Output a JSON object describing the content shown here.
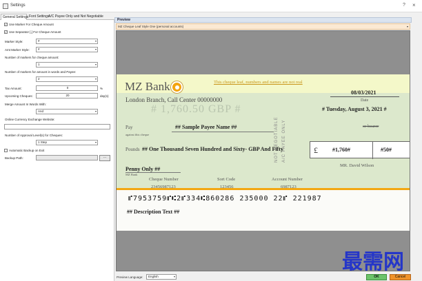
{
  "window": {
    "title": "Settings",
    "help": "?",
    "close": "×"
  },
  "tabs": [
    {
      "label": "General Settings"
    },
    {
      "label": "Font Settings"
    },
    {
      "label": "A/C Payee Only and Not Negotiable"
    }
  ],
  "settings": {
    "use_marker": {
      "label": "Use Marker For Cheque Amount",
      "checked": "✓"
    },
    "use_separator": {
      "label": "Use Separator [,] For Cheque Amount",
      "checked": "✓"
    },
    "marker_style": {
      "label": "Marker Style:",
      "value": "#"
    },
    "amt_marker_style": {
      "label": "Amt Marker Style:",
      "value": "#"
    },
    "markers_amount": {
      "label": "Number of markers for cheque amount:",
      "value": "1"
    },
    "markers_words": {
      "label": "Number of markers for amount in words and Payee:",
      "value": "2"
    },
    "tax_amount": {
      "label": "Tax Amount:",
      "value": "0",
      "unit": "%"
    },
    "upcoming": {
      "label": "Upcoming Cheques:",
      "value": "20",
      "unit": "day(s)"
    },
    "merge_words": {
      "label": "Merge Amount In Words With:",
      "value": "And"
    },
    "currency_site": {
      "label": "Online Currency Exchange Website:",
      "value": ""
    },
    "approval_levels": {
      "label": "Number of Approval Level(s) for Cheques:",
      "value": "1 Step"
    },
    "auto_backup": {
      "label": "Automatic Backup on Exit",
      "checked": ""
    },
    "backup_path": {
      "label": "Backup Path:",
      "value": "",
      "browse": "..."
    }
  },
  "preview": {
    "header": "Preview",
    "style": "MZ Cheque Leaf Style One (personal accounts)",
    "cheque": {
      "bank_name": "MZ Bank",
      "branch": "London Branch, Call Center 00000000",
      "disclaimer": "This cheque leaf, numbers and names are not real",
      "date": "08/03/2021",
      "date_label": "Date",
      "long_date": "# Tuesday, August 3, 2021 #",
      "ghost_amount": "# 1,760.50 GBP #",
      "pay_label": "Pay",
      "pay_sub": "against this cheque",
      "payee": "## Sample Payee Name ##",
      "bearer": "or bearer",
      "vertical_1": "NOT NEGOTIABLE",
      "vertical_2": "A/C PAYEE ONLY",
      "pounds_label": "Pounds",
      "words_line1": "## One Thousand Seven Hundred and Sixty- GBP And Fifty",
      "words_line2": "Penny Only ##",
      "bank_sub": "MZ Bank",
      "currency_symbol": "£",
      "amount": "#1,760#",
      "count": "#50#",
      "signer": "MR. David Wilson",
      "cheque_number_label": "Cheque Number",
      "cheque_number": "23456987123",
      "sort_code_label": "Sort Code",
      "sort_code": "123456",
      "account_number_label": "Account Number",
      "account_number": "6987123",
      "micr": "⑈7953759⑈⑆2⑈334⑆860286 235000 22⑈ 221987",
      "description": "## Description Text ##"
    }
  },
  "footer": {
    "language_label": "Preview Language:",
    "language": "English",
    "ok": "OK",
    "cancel": "Cancel"
  },
  "watermark": "最需网",
  "colors": {
    "accent_orange": "#f3a712",
    "ok_green": "#6cc36a",
    "cancel_orange": "#f0932b",
    "watermark_blue": "#2536c8"
  }
}
